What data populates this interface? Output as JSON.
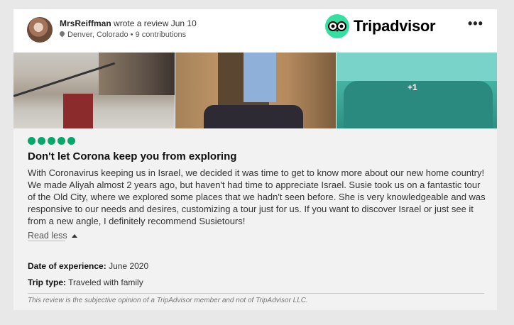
{
  "reviewer": {
    "name": "MrsReiffman",
    "action": "wrote a review Jun 10",
    "location": "Denver, Colorado",
    "contributions": "• 9 contributions"
  },
  "brand": {
    "name": "Tripadvisor",
    "color": "#34e0a1"
  },
  "menu": {
    "more_label": "•••"
  },
  "photos": {
    "more_count": "+1"
  },
  "rating": {
    "value": 5,
    "max": 5,
    "color": "#00aa6c"
  },
  "review": {
    "title": "Don't let Corona keep you from exploring",
    "text": "With Coronavirus keeping us in Israel, we decided it was time to get to know more about our new home country! We made Aliyah almost 2 years ago, but haven't had time to appreciate Israel. Susie took us on a fantastic tour of the Old City, where we explored some places that we hadn't seen before. She is very knowledgeable and was responsive to our needs and desires, customizing a tour just for us. If you want to discover Israel or just see it from a new angle, I definitely recommend Susietours!",
    "read_less": "Read less"
  },
  "details": {
    "date_label": "Date of experience:",
    "date_value": "June 2020",
    "trip_label": "Trip type:",
    "trip_value": "Traveled with family"
  },
  "disclaimer": "This review is the subjective opinion of a TripAdvisor member and not of TripAdvisor LLC."
}
